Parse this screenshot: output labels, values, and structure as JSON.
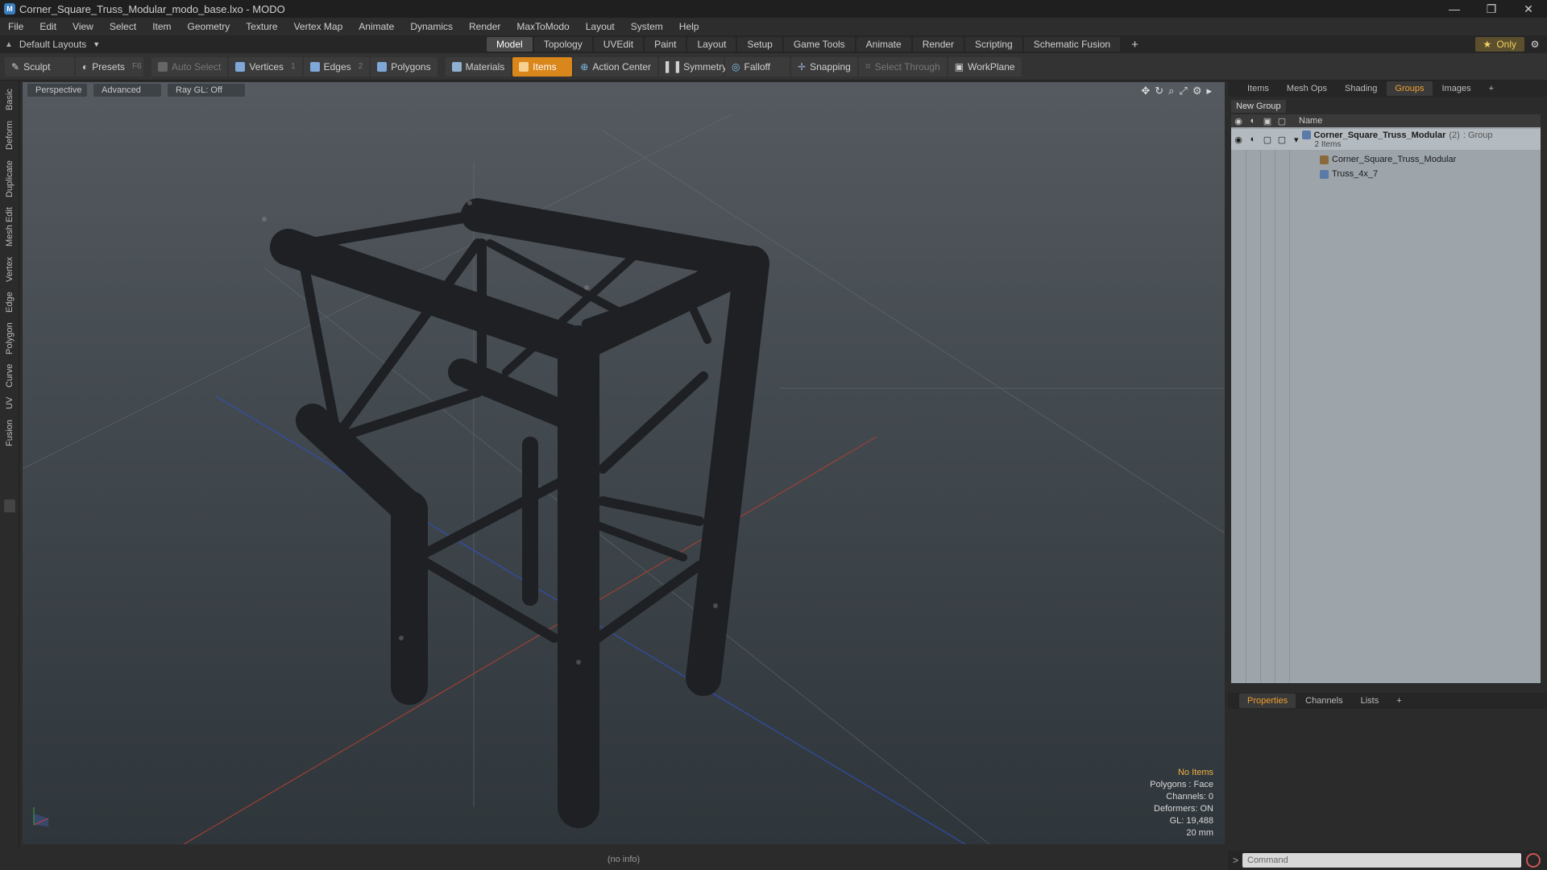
{
  "window": {
    "title": "Corner_Square_Truss_Modular_modo_base.lxo - MODO",
    "minimize": "—",
    "restore": "❐",
    "close": "✕"
  },
  "menu": [
    "File",
    "Edit",
    "View",
    "Select",
    "Item",
    "Geometry",
    "Texture",
    "Vertex Map",
    "Animate",
    "Dynamics",
    "Render",
    "MaxToModo",
    "Layout",
    "System",
    "Help"
  ],
  "layouts": {
    "selector": "Default Layouts",
    "tabs": [
      "Model",
      "Topology",
      "UVEdit",
      "Paint",
      "Layout",
      "Setup",
      "Game Tools",
      "Animate",
      "Render",
      "Scripting",
      "Schematic Fusion"
    ],
    "active_tab": "Model",
    "add": "+",
    "only": "Only"
  },
  "toolbar": {
    "sculpt": "Sculpt",
    "presets": "Presets",
    "presets_key": "F6",
    "auto_select": "Auto Select",
    "vertices": "Vertices",
    "vertices_key": "1",
    "edges": "Edges",
    "edges_key": "2",
    "polygons": "Polygons",
    "materials": "Materials",
    "items": "Items",
    "action_center": "Action Center",
    "symmetry": "Symmetry",
    "falloff": "Falloff",
    "snapping": "Snapping",
    "select_through": "Select Through",
    "workplane": "WorkPlane"
  },
  "left_tabs": [
    "Basic",
    "Deform",
    "Duplicate",
    "Mesh Edit",
    "Vertex",
    "Edge",
    "Polygon",
    "Curve",
    "UV",
    "Fusion"
  ],
  "viewport": {
    "view": "Perspective",
    "mode": "Advanced",
    "raygl": "Ray GL: Off",
    "info": {
      "no_items": "No Items",
      "polygons": "Polygons : Face",
      "channels": "Channels: 0",
      "deformers": "Deformers: ON",
      "gl": "GL: 19,488",
      "size": "20 mm"
    }
  },
  "status": "(no info)",
  "right_panel": {
    "tabs": [
      "Items",
      "Mesh Ops",
      "Shading",
      "Groups",
      "Images"
    ],
    "active_tab": "Groups",
    "add": "+",
    "new_group": "New Group",
    "col_name": "Name",
    "group": {
      "name": "Corner_Square_Truss_Modular",
      "count": "(2)",
      "type": ": Group",
      "sub": "2 Items"
    },
    "children": [
      "Corner_Square_Truss_Modular",
      "Truss_4x_7"
    ],
    "bottom_tabs": [
      "Properties",
      "Channels",
      "Lists"
    ],
    "bottom_active": "Properties",
    "command_placeholder": "Command"
  },
  "colors": {
    "accent": "#d9861b",
    "group_tab": "#f0a030",
    "info_warning": "#f0b040"
  }
}
